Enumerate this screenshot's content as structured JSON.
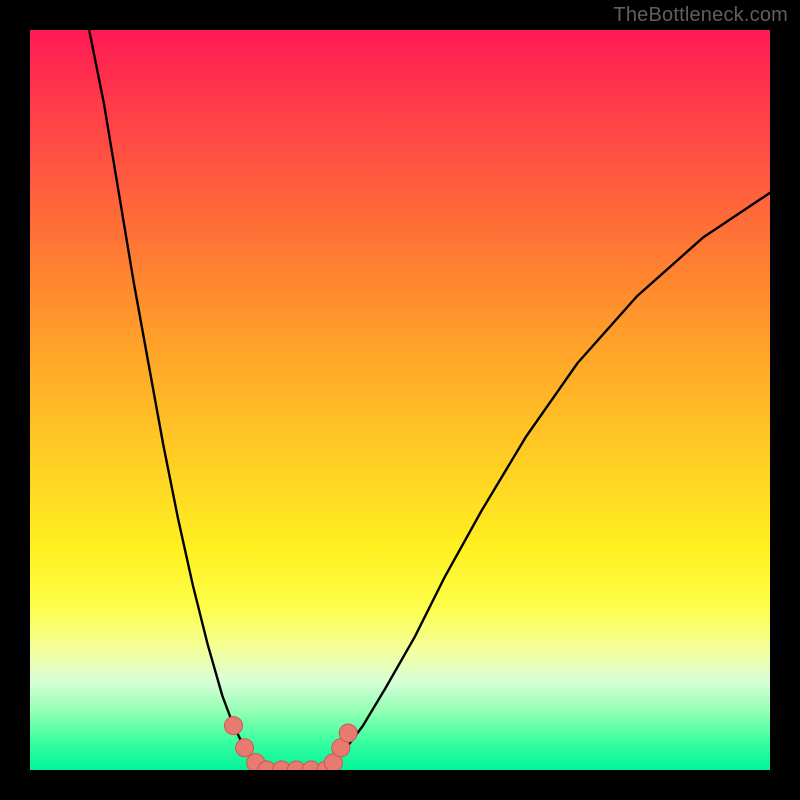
{
  "watermark": "TheBottleneck.com",
  "colors": {
    "frame": "#000000",
    "curve": "#000000",
    "marker_fill": "#e77a71",
    "marker_stroke": "#cf574f",
    "gradient_stops": [
      "#ff1a54",
      "#ff3b4a",
      "#ff5a3f",
      "#ff7a33",
      "#ff9a2a",
      "#ffc525",
      "#fff020",
      "#fdff4a",
      "#f4ffa0",
      "#d7ffd7",
      "#94ffb4",
      "#3dffa0",
      "#00f49a"
    ]
  },
  "chart_data": {
    "type": "line",
    "title": "",
    "xlabel": "",
    "ylabel": "",
    "xlim": [
      0,
      100
    ],
    "ylim": [
      0,
      100
    ],
    "series": [
      {
        "name": "left-branch",
        "x": [
          8,
          10,
          12,
          14,
          16,
          18,
          20,
          22,
          24,
          26,
          27.5,
          29,
          30.5,
          32
        ],
        "values": [
          100,
          90,
          78,
          66,
          55,
          44,
          34,
          25,
          17,
          10,
          6,
          3,
          1,
          0
        ]
      },
      {
        "name": "valley-floor",
        "x": [
          32,
          34,
          36,
          38,
          40
        ],
        "values": [
          0,
          0,
          0,
          0,
          0
        ]
      },
      {
        "name": "right-branch",
        "x": [
          40,
          42,
          45,
          48,
          52,
          56,
          61,
          67,
          74,
          82,
          91,
          100
        ],
        "values": [
          0,
          2,
          6,
          11,
          18,
          26,
          35,
          45,
          55,
          64,
          72,
          78
        ]
      }
    ],
    "markers": [
      {
        "x": 27.5,
        "y": 6
      },
      {
        "x": 29,
        "y": 3
      },
      {
        "x": 30.5,
        "y": 1
      },
      {
        "x": 32,
        "y": 0
      },
      {
        "x": 34,
        "y": 0
      },
      {
        "x": 36,
        "y": 0
      },
      {
        "x": 38,
        "y": 0
      },
      {
        "x": 40,
        "y": 0
      },
      {
        "x": 41,
        "y": 1
      },
      {
        "x": 42,
        "y": 3
      },
      {
        "x": 43,
        "y": 5
      }
    ]
  }
}
